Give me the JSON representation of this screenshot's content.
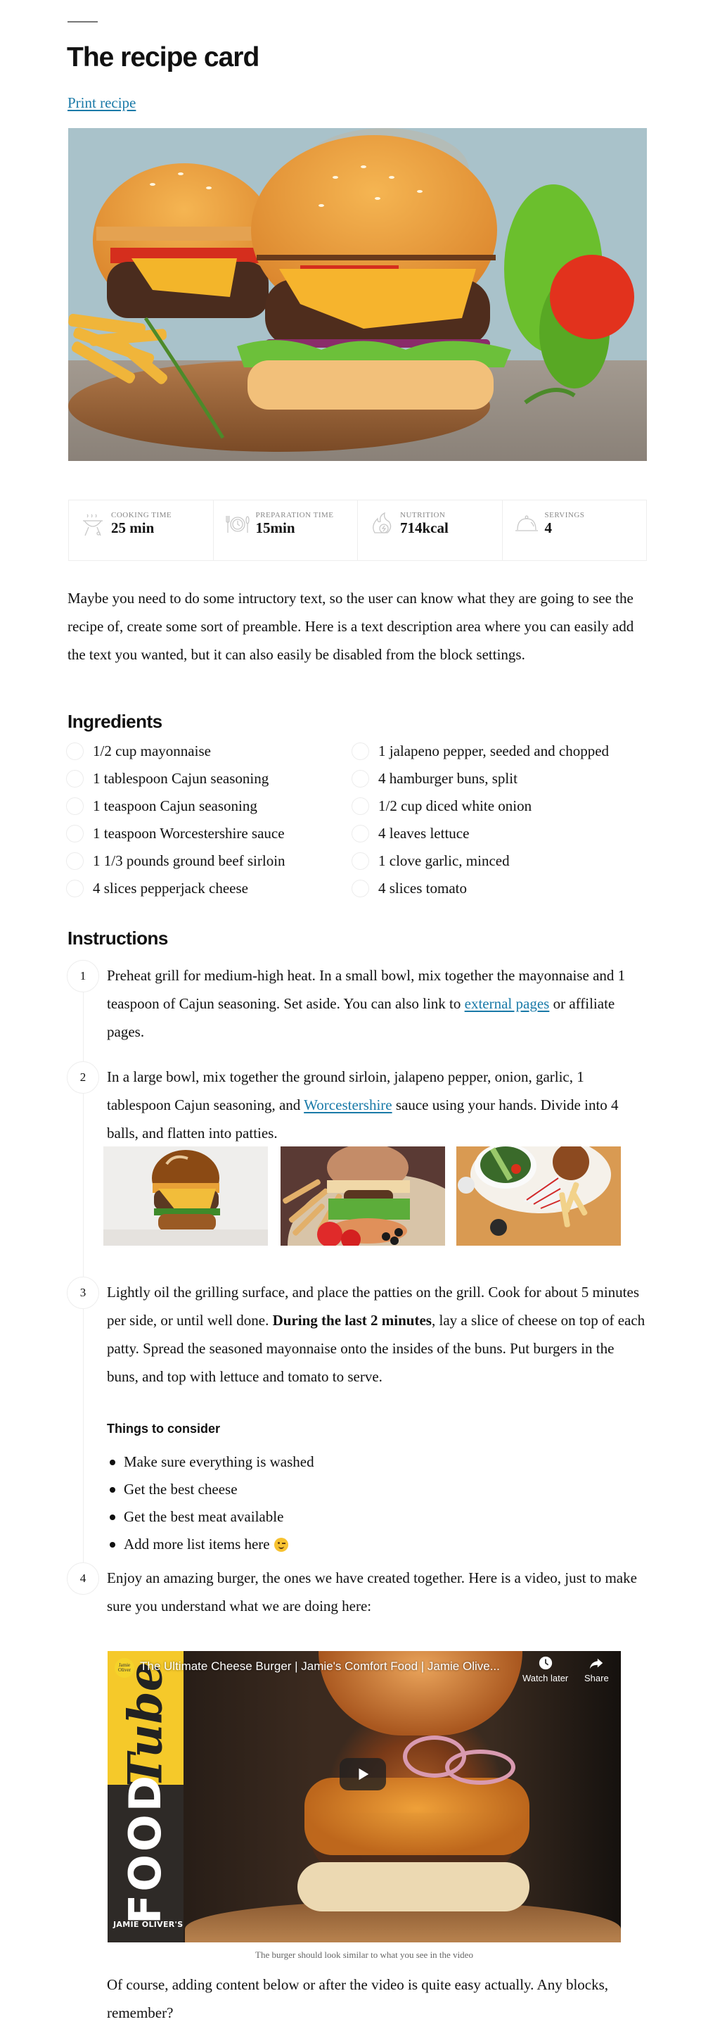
{
  "title": "The recipe card",
  "print_link": "Print recipe",
  "meta": [
    {
      "icon": "grill-icon",
      "label": "Cooking time",
      "value": "25 min"
    },
    {
      "icon": "plate-clock-icon",
      "label": "Preparation time",
      "value": "15min"
    },
    {
      "icon": "flame-energy-icon",
      "label": "Nutrition",
      "value": "714kcal"
    },
    {
      "icon": "cloche-icon",
      "label": "Servings",
      "value": "4"
    }
  ],
  "intro": "Maybe you need to do some intructory text, so the user can know what they are going to see the recipe of, create some sort of preamble. Here is a text description area where you can easily add the text you wanted, but it can also easily be disabled from the block settings.",
  "ingredients": {
    "title": "Ingredients",
    "left": [
      "1/2 cup mayonnaise",
      "1 tablespoon Cajun seasoning",
      "1 teaspoon Cajun seasoning",
      "1 teaspoon Worcestershire sauce",
      "1 1/3 pounds ground beef sirloin",
      "4 slices pepperjack cheese"
    ],
    "right": [
      "1 jalapeno pepper, seeded and chopped",
      "4 hamburger buns, split",
      "1/2 cup diced white onion",
      "4 leaves lettuce",
      "1 clove garlic, minced",
      "4 slices tomato"
    ]
  },
  "instructions": {
    "title": "Instructions",
    "steps": [
      {
        "number": "1",
        "text_before": "Preheat grill for medium-high heat. In a small bowl, mix together the mayonnaise and 1 teaspoon of Cajun seasoning. Set aside. You can also link to ",
        "link": "external pages",
        "text_after": " or affiliate pages."
      },
      {
        "number": "2",
        "text_before": "In a large bowl, mix together the ground sirloin, jalapeno pepper, onion, garlic, 1 tablespoon Cajun seasoning, and ",
        "link": "Worcestershire",
        "text_after": " sauce using your hands. Divide into 4 balls, and flatten into patties.",
        "gallery": [
          "pretzel-bun-burger-photo",
          "burger-with-fries-and-olives-photo",
          "burger-and-salad-top-view-photo"
        ]
      },
      {
        "number": "3",
        "text_before": "Lightly oil the grilling surface, and place the patties on the grill. Cook for about 5 minutes per side, or until well done. ",
        "bold": "During the last 2 minutes",
        "text_after": ", lay a slice of cheese on top of each patty. Spread the seasoned mayonnaise onto the insides of the buns. Put burgers in the buns, and top with lettuce and tomato to serve.",
        "subheading": "Things to consider",
        "tips": [
          "Make sure everything is washed",
          "Get the best cheese",
          "Get the best meat available",
          "Add more list items here"
        ]
      },
      {
        "number": "4",
        "text": "Enjoy an amazing burger, the ones we have created together. Here is a video, just to make sure you understand what we are doing here:"
      }
    ]
  },
  "video": {
    "title": "The Ultimate Cheese Burger | Jamie's Comfort Food | Jamie Olive...",
    "channel_avatar": "Jamie Oliver",
    "watch_later": "Watch later",
    "share": "Share",
    "thumb_text_tube": "Tube",
    "thumb_text_food": "FOOD",
    "thumb_text_brand": "JAMIE OLIVER'S",
    "caption": "The burger should look similar to what you see in the video"
  },
  "outro": "Of course, adding content below or after the video is quite easy actually. Any blocks, remember?",
  "colors": {
    "link": "#1a7aa8",
    "border": "#eeeeee",
    "text": "#111111"
  }
}
